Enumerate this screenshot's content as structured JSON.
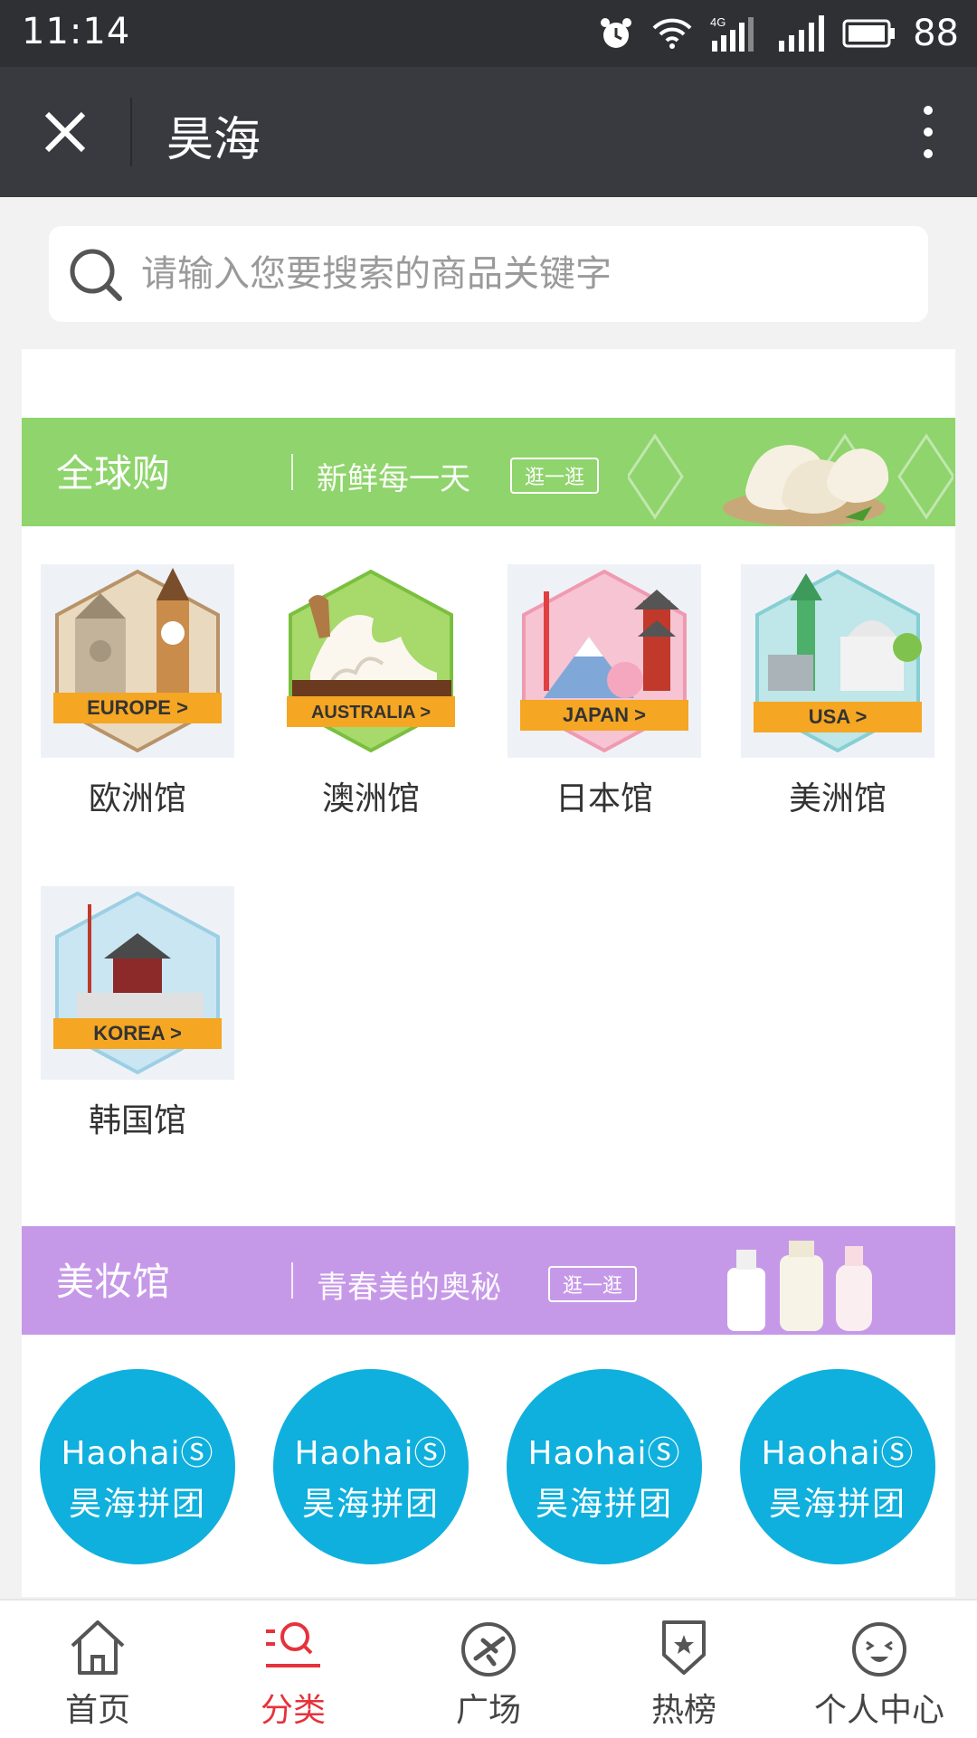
{
  "status_bar": {
    "time": "11:14",
    "battery": "88",
    "network": "4G"
  },
  "title_bar": {
    "title": "昊海"
  },
  "search": {
    "placeholder": "请输入您要搜索的商品关键字"
  },
  "sections": [
    {
      "title": "全球购",
      "slogan": "新鲜每一天",
      "cta": "逛一逛",
      "color": "#8fd46c",
      "pavilions": [
        {
          "label": "欧洲馆",
          "badge": "EUROPE >",
          "badge_color": "#e9d9bf"
        },
        {
          "label": "澳洲馆",
          "badge": "AUSTRALIA >",
          "badge_color": "#a7d96b"
        },
        {
          "label": "日本馆",
          "badge": "JAPAN >",
          "badge_color": "#f6c4d2"
        },
        {
          "label": "美洲馆",
          "badge": "USA >",
          "badge_color": "#bfe6e8"
        },
        {
          "label": "韩国馆",
          "badge": "KOREA >",
          "badge_color": "#c9e6f2"
        }
      ]
    },
    {
      "title": "美妆馆",
      "slogan": "青春美的奥秘",
      "cta": "逛一逛",
      "color": "#c699e8",
      "groups": [
        {
          "brand": "HaohaiⓈ",
          "name": "昊海拼团"
        },
        {
          "brand": "HaohaiⓈ",
          "name": "昊海拼团"
        },
        {
          "brand": "HaohaiⓈ",
          "name": "昊海拼团"
        },
        {
          "brand": "HaohaiⓈ",
          "name": "昊海拼团"
        }
      ]
    }
  ],
  "tabs": [
    {
      "label": "首页",
      "icon": "home-icon",
      "active": false
    },
    {
      "label": "分类",
      "icon": "category-search-icon",
      "active": true
    },
    {
      "label": "广场",
      "icon": "plaza-plane-icon",
      "active": false
    },
    {
      "label": "热榜",
      "icon": "ranking-shield-icon",
      "active": false
    },
    {
      "label": "个人中心",
      "icon": "smiley-face-icon",
      "active": false
    }
  ],
  "colors": {
    "accent": "#e6323c",
    "group_circle": "#0fb0dd",
    "title_bar": "#393a3f",
    "badge_bar": "#f5a623"
  }
}
